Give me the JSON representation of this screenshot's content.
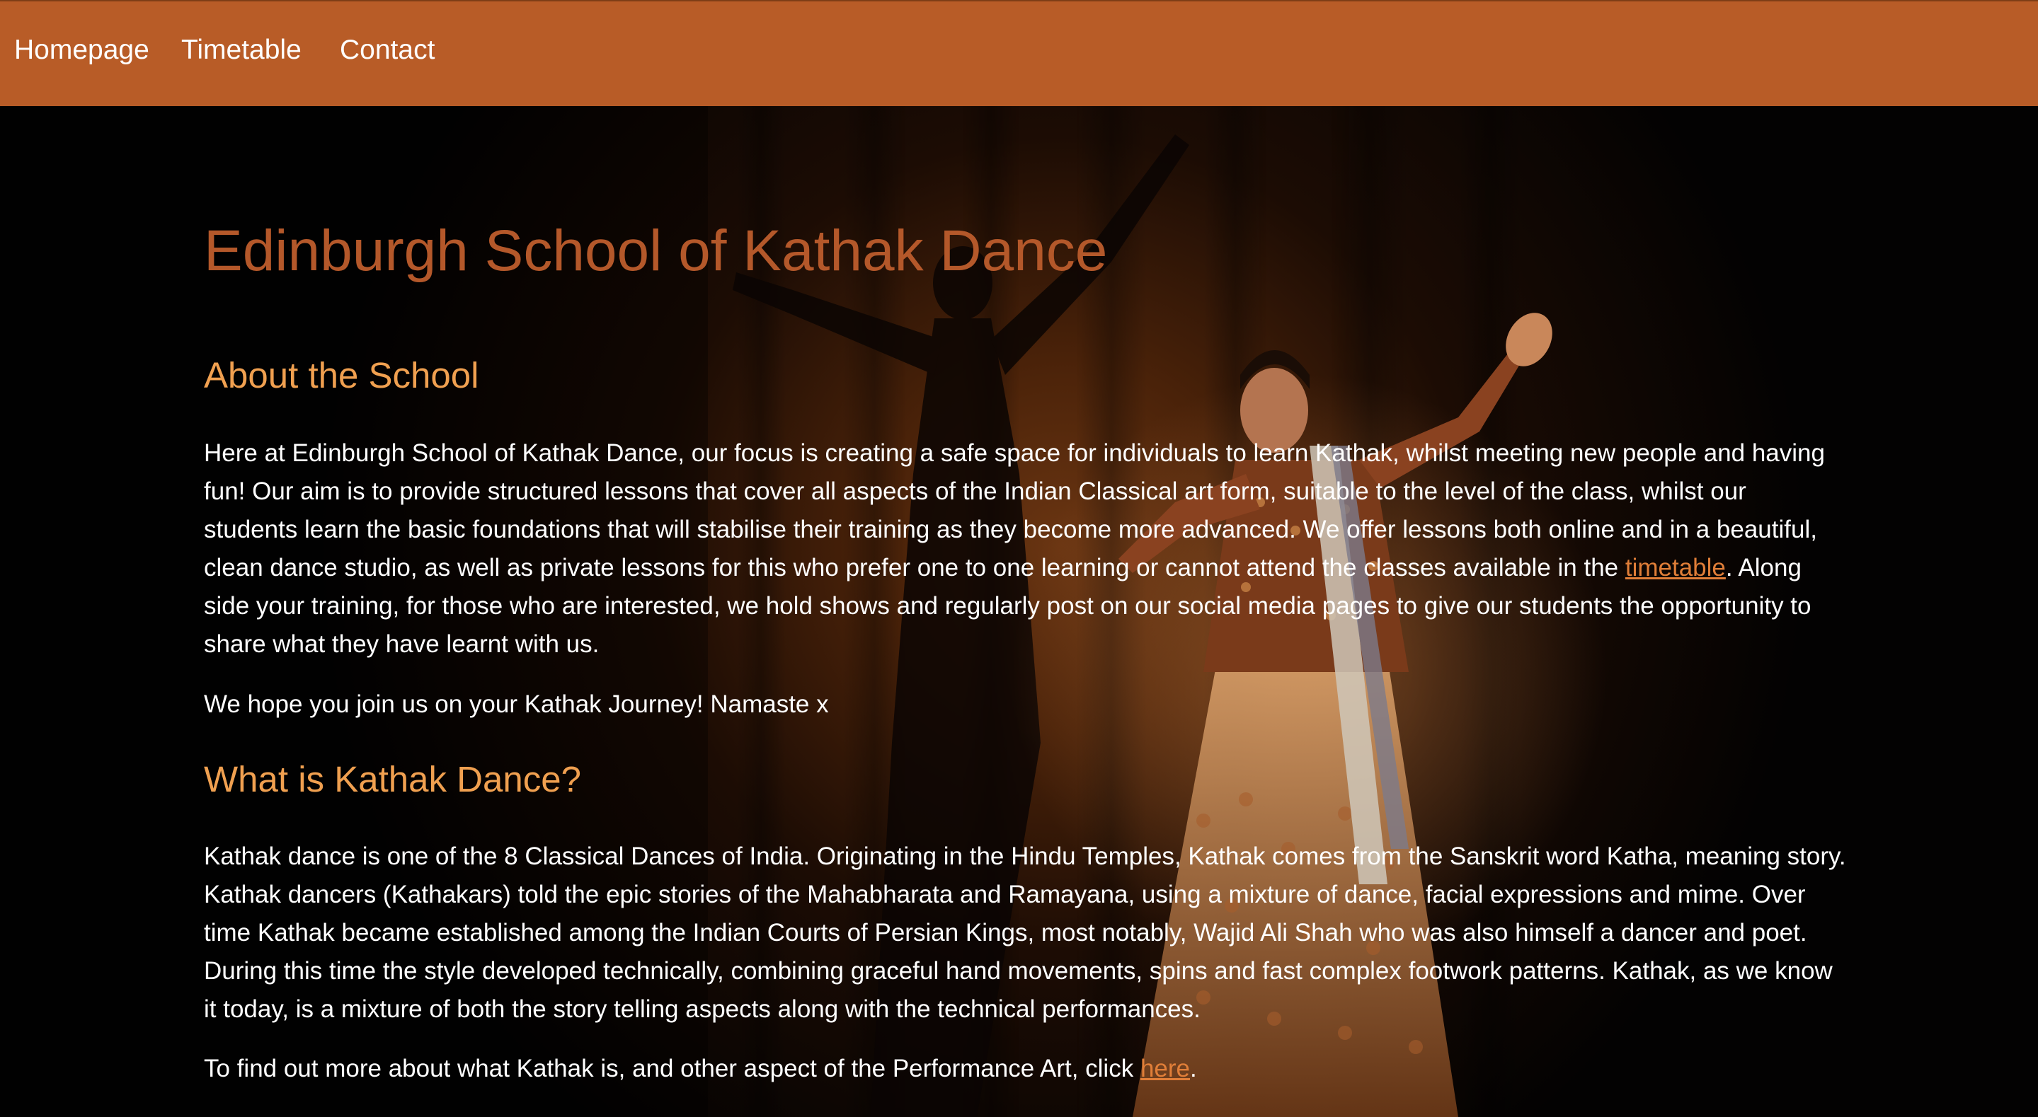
{
  "nav": {
    "items": [
      "Homepage",
      "Timetable",
      "Contact"
    ]
  },
  "colors": {
    "navbar_bg": "#b85c27",
    "title": "#b4582a",
    "heading": "#f0a050",
    "link": "#e07e38",
    "text": "#ffffff",
    "page_bg": "#030202"
  },
  "hero": {
    "title": "Edinburgh School of Kathak Dance"
  },
  "about": {
    "heading": "About the School",
    "p1_before_link": "Here at Edinburgh School of Kathak Dance, our focus is creating a safe space for individuals to learn Kathak, whilst meeting new people and having fun! Our aim is to provide structured lessons that cover all aspects of the Indian Classical art form, suitable to the level of the class, whilst our students learn the basic foundations that will stabilise their training as they become more advanced. We offer lessons both online and in a beautiful, clean dance studio, as well as private lessons for this who prefer one to one learning or cannot attend the classes available in the ",
    "p1_link": "timetable",
    "p1_after_link": ". Along side your training, for those who are interested, we hold shows and regularly post on our social media pages to give our students the opportunity to share what they have learnt with us.",
    "p2": "We hope you join us on your Kathak Journey! Namaste x"
  },
  "kathak": {
    "heading": "What is Kathak Dance?",
    "p1": "Kathak dance is one of the 8 Classical Dances of India. Originating in the Hindu Temples, Kathak comes from the Sanskrit word Katha, meaning story. Kathak dancers (Kathakars) told the epic stories of the Mahabharata and Ramayana, using a mixture of dance, facial expressions and mime. Over time Kathak became established among the Indian Courts of Persian Kings, most notably, Wajid Ali Shah who was also himself a dancer and poet. During this time the style developed technically, combining graceful hand movements, spins and fast complex footwork patterns. Kathak, as we know it today, is a mixture of both the story telling aspects along with the technical performances.",
    "p2_before_link": "To find out more about what Kathak is, and other aspect of the Performance Art, click ",
    "p2_link": "here",
    "p2_after_link": "."
  }
}
